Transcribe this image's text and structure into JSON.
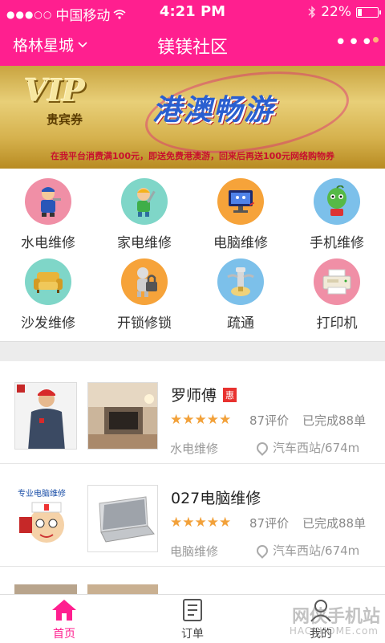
{
  "status": {
    "carrier": "中国移动",
    "time": "4:21 PM",
    "battery": "22%"
  },
  "header": {
    "city": "格林星城",
    "title": "镁镁社区"
  },
  "banner": {
    "vip": "VIP",
    "vip_sub": "贵宾券",
    "headline": "港澳畅游",
    "note": "在我平台消费满100元，即送免费港澳游，回来后再送100元网络购物券"
  },
  "categories": [
    {
      "label": "水电维修",
      "icon": "plumber-icon",
      "color": "#f08fa6"
    },
    {
      "label": "家电维修",
      "icon": "appliance-repair-icon",
      "color": "#7fd6c8"
    },
    {
      "label": "电脑维修",
      "icon": "computer-repair-icon",
      "color": "#f6a33a"
    },
    {
      "label": "手机维修",
      "icon": "phone-repair-icon",
      "color": "#7cc0ea"
    },
    {
      "label": "沙发维修",
      "icon": "sofa-icon",
      "color": "#7fd6c8"
    },
    {
      "label": "开锁修锁",
      "icon": "lock-icon",
      "color": "#f6a33a"
    },
    {
      "label": "疏通",
      "icon": "drain-icon",
      "color": "#7cc0ea"
    },
    {
      "label": "打印机",
      "icon": "printer-icon",
      "color": "#f08fa6"
    }
  ],
  "list": [
    {
      "name": "罗师傅",
      "badge": "惠",
      "stars": "★★★★★",
      "reviews": "87评价",
      "done": "已完成88单",
      "category": "水电维修",
      "location": "汽车西站/674m"
    },
    {
      "name": "027电脑维修",
      "badge": "",
      "stars": "★★★★★",
      "reviews": "87评价",
      "done": "已完成88单",
      "category": "电脑维修",
      "location": "汽车西站/674m"
    }
  ],
  "tabs": {
    "home": "首页",
    "orders": "订单",
    "mine": "我的"
  },
  "watermark": {
    "main": "网侠手机站",
    "sub": "HACKHOME.com"
  },
  "colors": {
    "accent": "#ff1f8f",
    "star": "#f2a13a"
  }
}
